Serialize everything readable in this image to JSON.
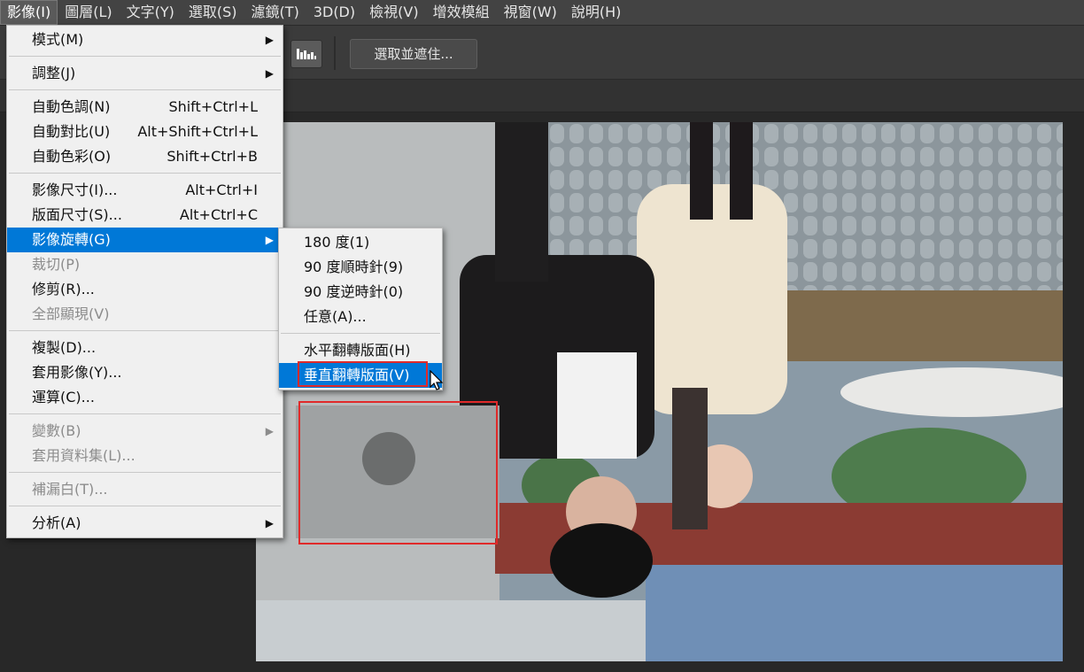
{
  "menubar": {
    "items": [
      "影像(I)",
      "圖層(L)",
      "文字(Y)",
      "選取(S)",
      "濾鏡(T)",
      "3D(D)",
      "檢視(V)",
      "增效模組",
      "視窗(W)",
      "說明(H)"
    ]
  },
  "optionsbar": {
    "select_and_mask": "選取並遮住..."
  },
  "image_menu": {
    "items": [
      {
        "label": "模式(M)",
        "shortcut": "",
        "submenu": true,
        "disabled": false
      },
      {
        "sep": true
      },
      {
        "label": "調整(J)",
        "shortcut": "",
        "submenu": true,
        "disabled": false
      },
      {
        "sep": true
      },
      {
        "label": "自動色調(N)",
        "shortcut": "Shift+Ctrl+L",
        "submenu": false,
        "disabled": false
      },
      {
        "label": "自動對比(U)",
        "shortcut": "Alt+Shift+Ctrl+L",
        "submenu": false,
        "disabled": false
      },
      {
        "label": "自動色彩(O)",
        "shortcut": "Shift+Ctrl+B",
        "submenu": false,
        "disabled": false
      },
      {
        "sep": true
      },
      {
        "label": "影像尺寸(I)...",
        "shortcut": "Alt+Ctrl+I",
        "submenu": false,
        "disabled": false
      },
      {
        "label": "版面尺寸(S)...",
        "shortcut": "Alt+Ctrl+C",
        "submenu": false,
        "disabled": false
      },
      {
        "label": "影像旋轉(G)",
        "shortcut": "",
        "submenu": true,
        "disabled": false,
        "highlight": true
      },
      {
        "label": "裁切(P)",
        "shortcut": "",
        "submenu": false,
        "disabled": true
      },
      {
        "label": "修剪(R)...",
        "shortcut": "",
        "submenu": false,
        "disabled": false
      },
      {
        "label": "全部顯現(V)",
        "shortcut": "",
        "submenu": false,
        "disabled": true
      },
      {
        "sep": true
      },
      {
        "label": "複製(D)...",
        "shortcut": "",
        "submenu": false,
        "disabled": false
      },
      {
        "label": "套用影像(Y)...",
        "shortcut": "",
        "submenu": false,
        "disabled": false
      },
      {
        "label": "運算(C)...",
        "shortcut": "",
        "submenu": false,
        "disabled": false
      },
      {
        "sep": true
      },
      {
        "label": "變數(B)",
        "shortcut": "",
        "submenu": true,
        "disabled": true
      },
      {
        "label": "套用資料集(L)...",
        "shortcut": "",
        "submenu": false,
        "disabled": true
      },
      {
        "sep": true
      },
      {
        "label": "補漏白(T)...",
        "shortcut": "",
        "submenu": false,
        "disabled": true
      },
      {
        "sep": true
      },
      {
        "label": "分析(A)",
        "shortcut": "",
        "submenu": true,
        "disabled": false
      }
    ]
  },
  "rotate_submenu": {
    "items": [
      {
        "label": "180 度(1)"
      },
      {
        "label": "90 度順時針(9)"
      },
      {
        "label": "90 度逆時針(0)"
      },
      {
        "label": "任意(A)..."
      },
      {
        "sep": true
      },
      {
        "label": "水平翻轉版面(H)"
      },
      {
        "label": "垂直翻轉版面(V)",
        "highlight": true
      }
    ]
  },
  "colors": {
    "highlight": "#0078d7",
    "annotation": "#e02a2a"
  }
}
